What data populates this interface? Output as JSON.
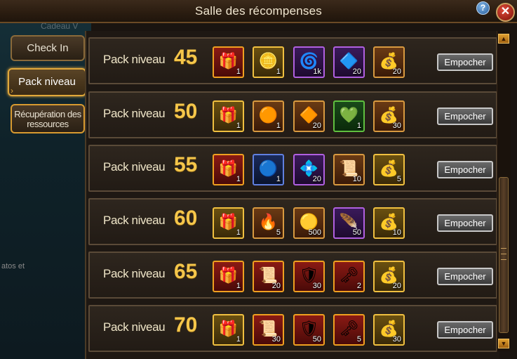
{
  "window": {
    "title": "Salle des récompenses",
    "help_label": "?",
    "close_label": "✕"
  },
  "background": {
    "ghost_text_top": "Cadeau V",
    "ghost_text_left": "atos et"
  },
  "sidebar": {
    "tabs": [
      {
        "label": "Check In",
        "active": false
      },
      {
        "label": "Pack niveau",
        "active": true
      },
      {
        "label": "Récupération des ressources",
        "active": false
      }
    ]
  },
  "rows": [
    {
      "label": "Pack niveau",
      "level": "45",
      "button": "Empocher",
      "items": [
        {
          "icon": "red-treasure-chest-icon",
          "glyph": "🎁",
          "frame": "red",
          "qty": "1"
        },
        {
          "icon": "gold-coin-orb-icon",
          "glyph": "🪙",
          "frame": "gold",
          "qty": "1"
        },
        {
          "icon": "pink-vortex-icon",
          "glyph": "🌀",
          "frame": "purple",
          "qty": "1k"
        },
        {
          "icon": "blue-rune-stone-icon",
          "glyph": "🔷",
          "frame": "purple",
          "qty": "20"
        },
        {
          "icon": "coin-sack-icon",
          "glyph": "💰",
          "frame": "orange",
          "qty": "20"
        }
      ]
    },
    {
      "label": "Pack niveau",
      "level": "50",
      "button": "Empocher",
      "items": [
        {
          "icon": "gold-treasure-chest-icon",
          "glyph": "🎁",
          "frame": "gold",
          "qty": "1"
        },
        {
          "icon": "orange-orb-icon",
          "glyph": "🟠",
          "frame": "orange",
          "qty": "1"
        },
        {
          "icon": "orange-crystal-icon",
          "glyph": "🔶",
          "frame": "orange",
          "qty": "20"
        },
        {
          "icon": "green-gem-icon",
          "glyph": "💚",
          "frame": "green",
          "qty": "1"
        },
        {
          "icon": "coin-sack-icon",
          "glyph": "💰",
          "frame": "orange",
          "qty": "30"
        }
      ]
    },
    {
      "label": "Pack niveau",
      "level": "55",
      "button": "Empocher",
      "items": [
        {
          "icon": "red-treasure-chest-icon",
          "glyph": "🎁",
          "frame": "red",
          "qty": "1"
        },
        {
          "icon": "blue-orb-icon",
          "glyph": "🔵",
          "frame": "blue",
          "qty": "1"
        },
        {
          "icon": "blue-crystal-icon",
          "glyph": "💠",
          "frame": "purple",
          "qty": "20"
        },
        {
          "icon": "scroll-icon",
          "glyph": "📜",
          "frame": "orange",
          "qty": "10"
        },
        {
          "icon": "gold-pile-icon",
          "glyph": "💰",
          "frame": "gold",
          "qty": "5"
        }
      ]
    },
    {
      "label": "Pack niveau",
      "level": "60",
      "button": "Empocher",
      "items": [
        {
          "icon": "gold-treasure-chest-icon",
          "glyph": "🎁",
          "frame": "gold",
          "qty": "1"
        },
        {
          "icon": "fire-swirl-icon",
          "glyph": "🔥",
          "frame": "orange",
          "qty": "5"
        },
        {
          "icon": "gold-ring-icon",
          "glyph": "🟡",
          "frame": "orange",
          "qty": "500"
        },
        {
          "icon": "purple-feather-icon",
          "glyph": "🪶",
          "frame": "purple",
          "qty": "50"
        },
        {
          "icon": "coin-sack-icon",
          "glyph": "💰",
          "frame": "gold",
          "qty": "10"
        }
      ]
    },
    {
      "label": "Pack niveau",
      "level": "65",
      "button": "Empocher",
      "items": [
        {
          "icon": "red-treasure-chest-icon",
          "glyph": "🎁",
          "frame": "red",
          "qty": "1"
        },
        {
          "icon": "red-scroll-icon",
          "glyph": "📜",
          "frame": "red",
          "qty": "20"
        },
        {
          "icon": "red-shield-fragment-icon",
          "glyph": "🛡",
          "frame": "red",
          "qty": "30"
        },
        {
          "icon": "golden-key-icon",
          "glyph": "🗝",
          "frame": "red",
          "qty": "2"
        },
        {
          "icon": "gold-pile-icon",
          "glyph": "💰",
          "frame": "gold",
          "qty": "20"
        }
      ]
    },
    {
      "label": "Pack niveau",
      "level": "70",
      "button": "Empocher",
      "items": [
        {
          "icon": "gold-treasure-chest-icon",
          "glyph": "🎁",
          "frame": "gold",
          "qty": "1"
        },
        {
          "icon": "red-scroll-icon",
          "glyph": "📜",
          "frame": "red",
          "qty": "30"
        },
        {
          "icon": "red-shield-fragment-icon",
          "glyph": "🛡",
          "frame": "red",
          "qty": "50"
        },
        {
          "icon": "golden-key-icon",
          "glyph": "🗝",
          "frame": "red",
          "qty": "5"
        },
        {
          "icon": "gold-pile-icon",
          "glyph": "💰",
          "frame": "gold",
          "qty": "30"
        }
      ]
    }
  ],
  "scrollbar": {
    "up_label": "▲",
    "down_label": "▼"
  }
}
